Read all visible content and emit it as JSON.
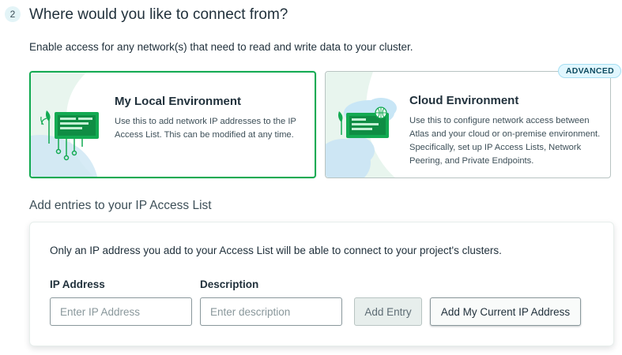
{
  "step": {
    "number": "2",
    "title": "Where would you like to connect from?",
    "description": "Enable access for any network(s) that need to read and write data to your cluster."
  },
  "options": [
    {
      "title": "My Local Environment",
      "text": "Use this to add network IP addresses to the IP Access List. This can be modified at any time.",
      "selected": true,
      "illustration": "laptop-network-icon"
    },
    {
      "title": "Cloud Environment",
      "text": "Use this to configure network access between Atlas and your cloud or on-premise environment. Specifically, set up IP Access Lists, Network Peering, and Private Endpoints.",
      "badge": "ADVANCED",
      "selected": false,
      "illustration": "cloud-network-icon"
    }
  ],
  "access_list": {
    "section_title": "Add entries to your IP Access List",
    "description": "Only an IP address you add to your Access List will be able to connect to your project's clusters.",
    "ip_label": "IP Address",
    "ip_placeholder": "Enter IP Address",
    "ip_value": "",
    "desc_label": "Description",
    "desc_placeholder": "Enter description",
    "desc_value": "",
    "add_entry_label": "Add Entry",
    "add_current_ip_label": "Add My Current IP Address"
  },
  "colors": {
    "accent_green": "#13aa52",
    "card_green": "#13aa52",
    "badge_bg": "#e1f7ff"
  }
}
